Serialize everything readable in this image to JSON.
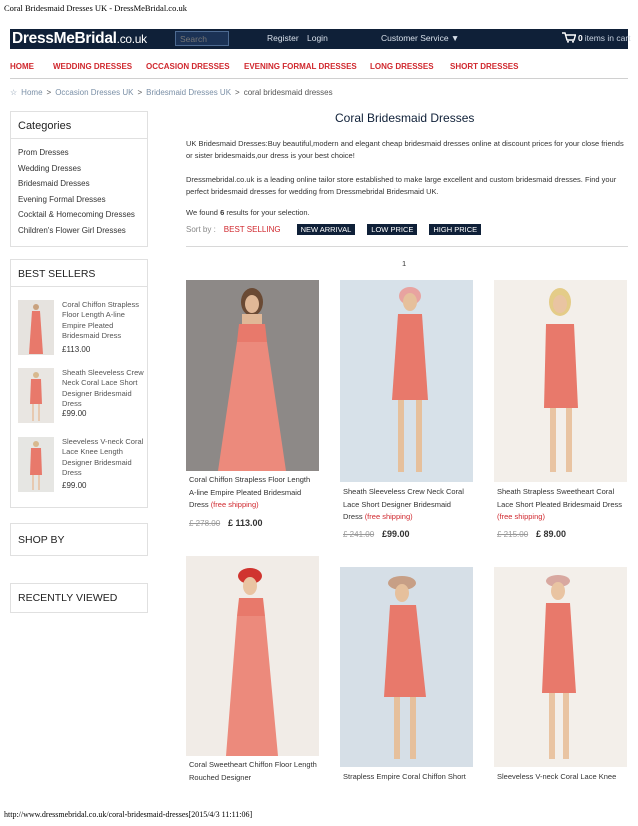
{
  "print_header": "Coral Bridesmaid Dresses UK - DressMeBridal.co.uk",
  "print_footer": "http://www.dressmebridal.co.uk/coral-bridesmaid-dresses[2015/4/3 11:11:06]",
  "header": {
    "logo_main": "DressMeBridal",
    "logo_suffix": ".co.uk",
    "search_placeholder": "Search",
    "register": "Register",
    "login": "Login",
    "customer_service": "Customer Service ▼",
    "cart_count": "0",
    "cart_text": "items in cart"
  },
  "nav": [
    "HOME",
    "WEDDING DRESSES",
    "OCCASION DRESSES",
    "EVENING FORMAL DRESSES",
    "LONG DRESSES",
    "SHORT DRESSES"
  ],
  "breadcrumb": {
    "home": "Home",
    "sep": ">",
    "l1": "Occasion Dresses UK",
    "l2": "Bridesmaid Dresses UK",
    "current": "coral bridesmaid dresses"
  },
  "sidebar": {
    "categories_title": "Categories",
    "categories": [
      "Prom Dresses",
      "Wedding Dresses",
      "Bridesmaid Dresses",
      "Evening Formal Dresses",
      "Cocktail & Homecoming Dresses",
      "Children's Flower Girl Dresses"
    ],
    "bestsellers_title": "BEST SELLERS",
    "bestsellers": [
      {
        "name": "Coral Chiffon Strapless Floor Length A-line Empire Pleated Bridesmaid Dress",
        "price": "£113.00"
      },
      {
        "name": "Sheath Sleeveless Crew Neck Coral Lace Short Designer Bridesmaid Dress",
        "price": "£99.00"
      },
      {
        "name": "Sleeveless V-neck Coral Lace Knee Length Designer Bridesmaid Dress",
        "price": "£99.00"
      }
    ],
    "shopby_title": "SHOP BY",
    "recent_title": "RECENTLY VIEWED"
  },
  "content": {
    "title": "Coral Bridesmaid Dresses",
    "para1": "UK Bridesmaid Dresses:Buy beautiful,modern and elegant cheap bridesmaid dresses online at discount prices for your close friends or sister bridesmaids,our dress is your best choice!",
    "para2": "Dressmebridal.co.uk is a leading online tailor store established to make large excellent and custom bridesmaid dresses. Find your perfect bridesmaid dresses for wedding from Dressmebridal Bridesmaid UK.",
    "found_prefix": "We found ",
    "found_count": "6",
    "found_suffix": " results for your selection.",
    "sort_label": "Sort by :",
    "sort_options": [
      "BEST SELLING",
      "NEW ARRIVAL",
      "LOW PRICE",
      "HIGH PRICE"
    ],
    "page": "1"
  },
  "products": [
    {
      "name": "Coral Chiffon Strapless Floor Length A-line Empire Pleated Bridesmaid Dress",
      "shipping": "(free shipping)",
      "old_price": "£ 278.00",
      "price": "£ 113.00"
    },
    {
      "name": "Sheath Sleeveless Crew Neck Coral Lace Short Designer Bridesmaid Dress",
      "shipping": "(free shipping)",
      "old_price": "£ 241.00",
      "price": "£99.00"
    },
    {
      "name": "Sheath Strapless Sweetheart Coral Lace Short Pleated Bridesmaid Dress",
      "shipping": "(free shipping)",
      "old_price": "£ 215.00",
      "price": "£ 89.00"
    },
    {
      "name": "Coral Sweetheart Chiffon Floor Length Rouched Designer"
    },
    {
      "name": "Strapless Empire Coral Chiffon Short"
    },
    {
      "name": "Sleeveless V-neck Coral Lace Knee"
    }
  ],
  "colors": {
    "navy": "#0f2038",
    "accent_red": "#d0282e",
    "coral": "#e8796b"
  }
}
